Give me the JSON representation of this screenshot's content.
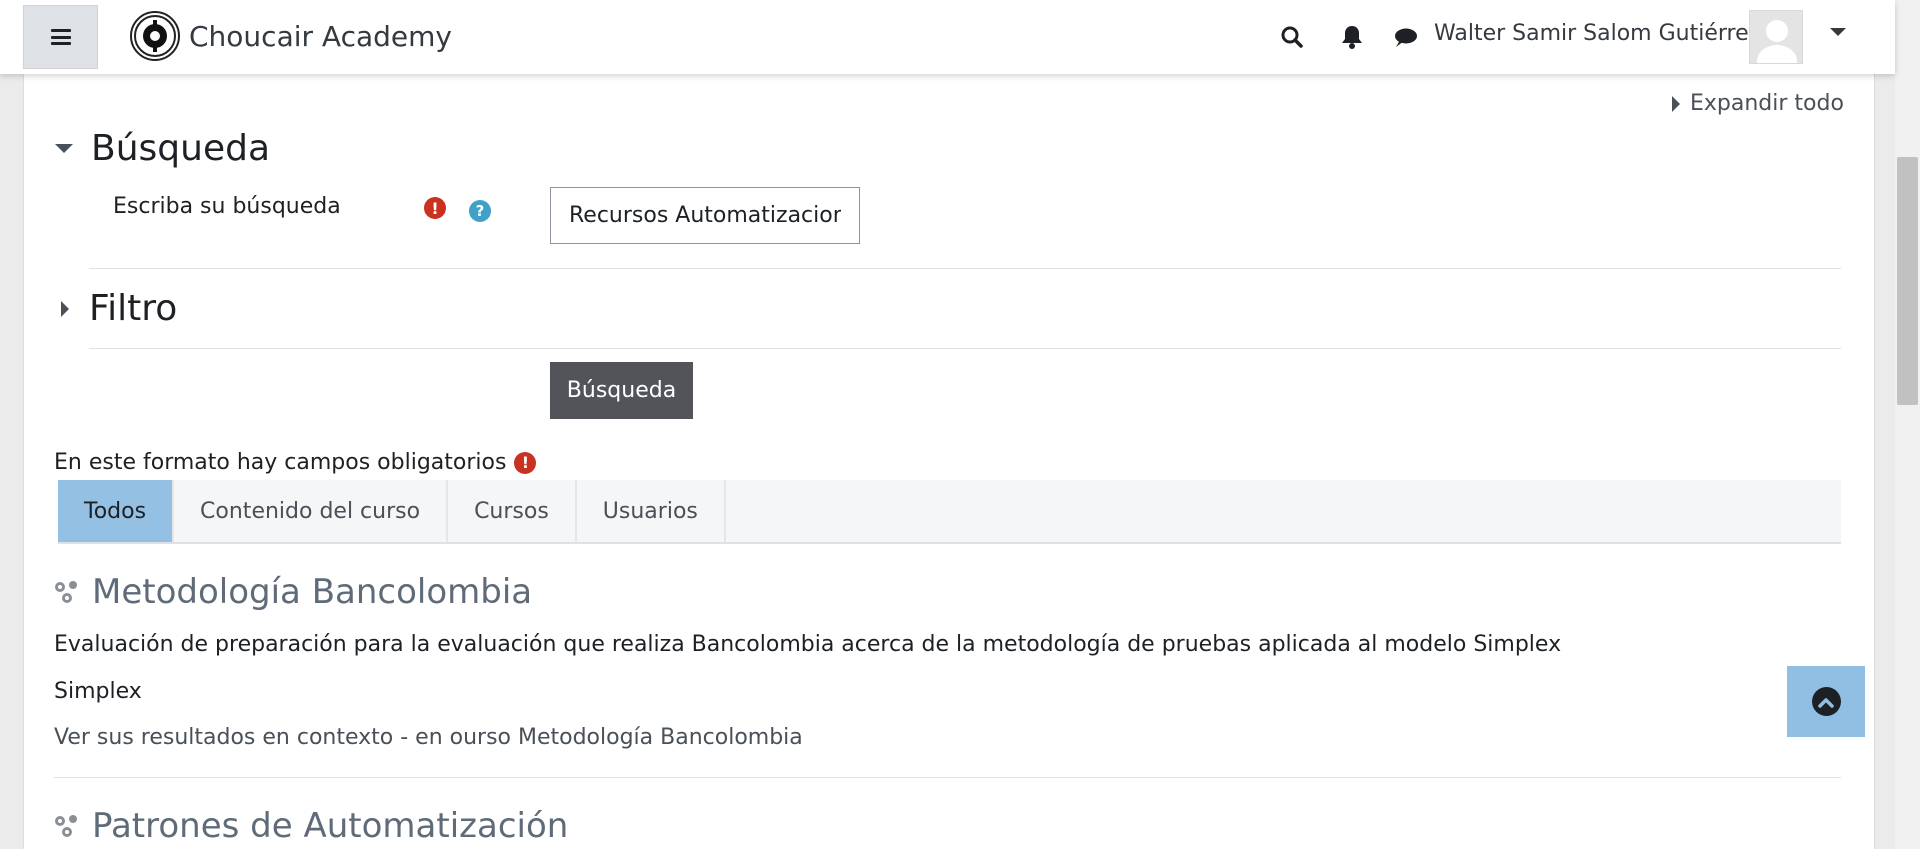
{
  "navbar": {
    "site_name": "Choucair Academy",
    "user_name": "Walter Samir Salom Gutiérrez",
    "icons": [
      "hamburger-icon",
      "search-icon",
      "bell-icon",
      "chat-icon",
      "chevron-down-icon"
    ]
  },
  "form": {
    "expand_all": "Expandir todo",
    "search_section": "Búsqueda",
    "search_label": "Escriba su búsqueda",
    "search_value": "Recursos Automatizacion",
    "filter_section": "Filtro",
    "submit_label": "Búsqueda",
    "required_note": "En este formato hay campos obligatorios"
  },
  "tabs": [
    {
      "label": "Todos",
      "active": true
    },
    {
      "label": "Contenido del curso",
      "active": false
    },
    {
      "label": "Cursos",
      "active": false
    },
    {
      "label": "Usuarios",
      "active": false
    }
  ],
  "results": [
    {
      "title": "Metodología Bancolombia",
      "description": "Evaluación de preparación para la evaluación que realiza Bancolombia acerca de la metodología de pruebas aplicada al modelo Simplex",
      "tag": "Simplex",
      "context_link": "Ver sus resultados en contexto - en ourso Metodología Bancolombia"
    },
    {
      "title": "Patrones de Automatización"
    }
  ],
  "colors": {
    "active_tab": "#93c0e3",
    "required": "#ca3120",
    "help": "#40a0c8",
    "submit": "#52545a",
    "back_to_top": "#90bfe3"
  }
}
